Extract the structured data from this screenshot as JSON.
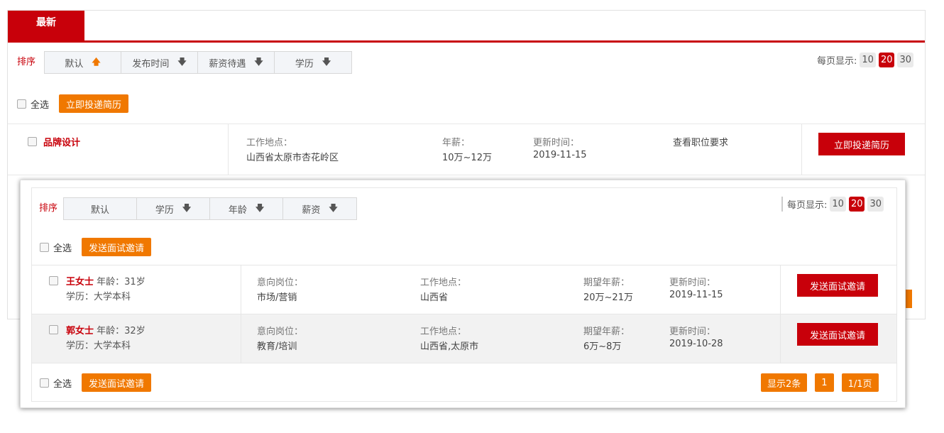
{
  "back_panel": {
    "tab_label": "最新",
    "sort": {
      "label": "排序",
      "options": [
        {
          "label": "默认",
          "arrow": "🡅"
        },
        {
          "label": "发布时间",
          "arrow": "🡇"
        },
        {
          "label": "薪资待遇",
          "arrow": "🡇"
        },
        {
          "label": "学历",
          "arrow": "🡇"
        }
      ]
    },
    "per_page": {
      "label": "每页显示:",
      "options": [
        "10",
        "20",
        "30"
      ],
      "selected": "20"
    },
    "select_all": "全选",
    "submit_resume": "立即投递简历",
    "job": {
      "title": "品牌设计",
      "location_label": "工作地点：",
      "location": "山西省太原市杏花岭区",
      "salary_label": "年薪：",
      "salary": "10万~12万",
      "updated_label": "更新时间：",
      "updated": "2019-11-15",
      "view_requirements": "查看职位要求",
      "apply_button": "立即投递简历"
    }
  },
  "front_panel": {
    "sort": {
      "label": "排序",
      "options": [
        {
          "label": "默认",
          "arrow": ""
        },
        {
          "label": "学历",
          "arrow": "🡇"
        },
        {
          "label": "年龄",
          "arrow": "🡇"
        },
        {
          "label": "薪资",
          "arrow": "🡇"
        }
      ]
    },
    "per_page": {
      "label": "每页显示:",
      "options": [
        "10",
        "20",
        "30"
      ],
      "selected": "20"
    },
    "select_all": "全选",
    "send_invite": "发送面试邀请",
    "candidates": [
      {
        "name": "王女士",
        "age": "年龄：31岁",
        "education": "学历：大学本科",
        "position_label": "意向岗位：",
        "position": "市场/营销",
        "location_label": "工作地点：",
        "location": "山西省",
        "salary_label": "期望年薪：",
        "salary": "20万~21万",
        "updated_label": "更新时间：",
        "updated": "2019-11-15",
        "button": "发送面试邀请"
      },
      {
        "name": "郭女士",
        "age": "年龄：32岁",
        "education": "学历：大学本科",
        "position_label": "意向岗位：",
        "position": "教育/培训",
        "location_label": "工作地点：",
        "location": "山西省,太原市",
        "salary_label": "期望年薪：",
        "salary": "6万~8万",
        "updated_label": "更新时间：",
        "updated": "2019-10-28",
        "button": "发送面试邀请"
      }
    ],
    "footer": {
      "select_all": "全选",
      "send_invite": "发送面试邀请",
      "show_count": "显示2条",
      "page": "1",
      "page_info": "1/1页"
    }
  },
  "colors": {
    "brand_red": "#c8000a",
    "accent_orange": "#f07800"
  }
}
